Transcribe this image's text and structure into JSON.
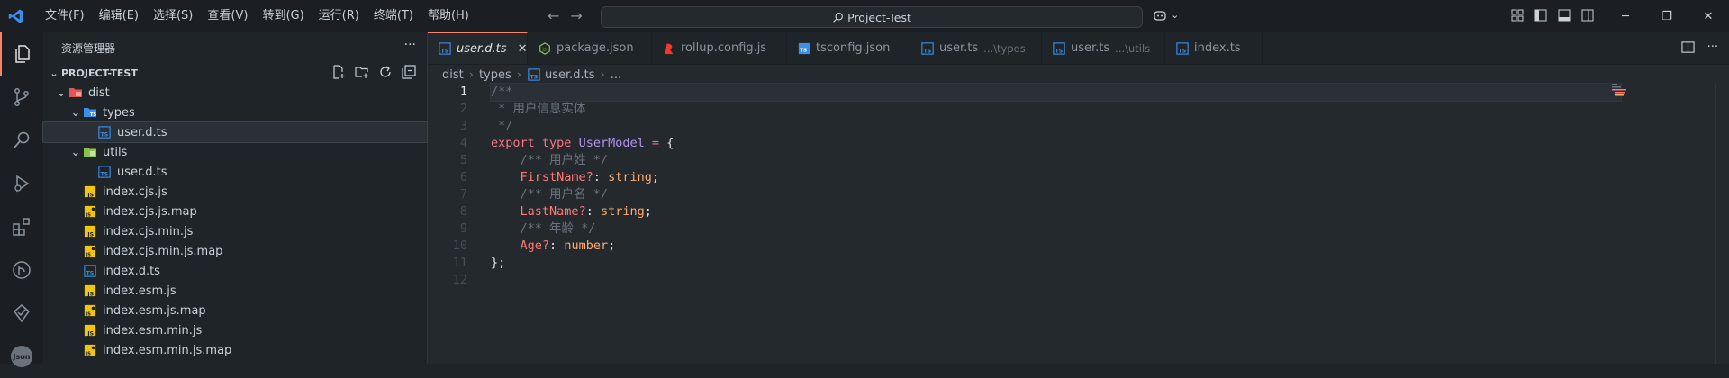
{
  "titlebar": {
    "menu": [
      "文件(F)",
      "编辑(E)",
      "选择(S)",
      "查看(V)",
      "转到(G)",
      "运行(R)",
      "终端(T)",
      "帮助(H)"
    ],
    "search_text": "Project-Test",
    "copilot_chevron": "⌄"
  },
  "colors": {
    "accent": "#f9826c",
    "ts_blue": "#3b8eea",
    "js_yellow": "#f1c40f",
    "npm_green": "#8bc34a",
    "rollup_red": "#ef3b2d"
  },
  "sidebar": {
    "title": "资源管理器",
    "more": "···",
    "project": "PROJECT-TEST",
    "tree": [
      {
        "label": "dist",
        "depth": 0,
        "kind": "folder-dist",
        "chev": "⌄"
      },
      {
        "label": "types",
        "depth": 1,
        "kind": "folder-types",
        "chev": "⌄"
      },
      {
        "label": "user.d.ts",
        "depth": 2,
        "kind": "ts",
        "selected": true
      },
      {
        "label": "utils",
        "depth": 1,
        "kind": "folder-utils",
        "chev": "⌄"
      },
      {
        "label": "user.d.ts",
        "depth": 2,
        "kind": "ts"
      },
      {
        "label": "index.cjs.js",
        "depth": 1,
        "kind": "js"
      },
      {
        "label": "index.cjs.js.map",
        "depth": 1,
        "kind": "map"
      },
      {
        "label": "index.cjs.min.js",
        "depth": 1,
        "kind": "js"
      },
      {
        "label": "index.cjs.min.js.map",
        "depth": 1,
        "kind": "map"
      },
      {
        "label": "index.d.ts",
        "depth": 1,
        "kind": "ts"
      },
      {
        "label": "index.esm.js",
        "depth": 1,
        "kind": "js"
      },
      {
        "label": "index.esm.js.map",
        "depth": 1,
        "kind": "map"
      },
      {
        "label": "index.esm.min.js",
        "depth": 1,
        "kind": "js"
      },
      {
        "label": "index.esm.min.js.map",
        "depth": 1,
        "kind": "map"
      }
    ]
  },
  "activity": {
    "bottom_badge": "Json"
  },
  "tabs": [
    {
      "label": "user.d.ts",
      "desc": "",
      "kind": "ts",
      "active": true,
      "width": 111
    },
    {
      "label": "package.json",
      "desc": "",
      "kind": "npm",
      "width": 138
    },
    {
      "label": "rollup.config.js",
      "desc": "",
      "kind": "rollup",
      "width": 150
    },
    {
      "label": "tsconfig.json",
      "desc": "",
      "kind": "tsconfig",
      "width": 137
    },
    {
      "label": "user.ts",
      "desc": "...\\types",
      "kind": "ts",
      "width": 146
    },
    {
      "label": "user.ts",
      "desc": "...\\utils",
      "kind": "ts",
      "width": 137
    },
    {
      "label": "index.ts",
      "desc": "",
      "kind": "ts",
      "width": 108
    }
  ],
  "breadcrumbs": [
    "dist",
    "types",
    "user.d.ts",
    "..."
  ],
  "code_lines": [
    {
      "n": "1",
      "current": true,
      "tokens": [
        [
          "c",
          "/**"
        ]
      ]
    },
    {
      "n": "2",
      "tokens": [
        [
          "c",
          " * 用户信息实体"
        ]
      ]
    },
    {
      "n": "3",
      "tokens": [
        [
          "c",
          " */"
        ]
      ]
    },
    {
      "n": "4",
      "tokens": [
        [
          "k",
          "export"
        ],
        [
          "p",
          " "
        ],
        [
          "k",
          "type"
        ],
        [
          "p",
          " "
        ],
        [
          "t",
          "UserModel"
        ],
        [
          "p",
          " "
        ],
        [
          "k",
          "="
        ],
        [
          "p",
          " {"
        ]
      ]
    },
    {
      "n": "5",
      "tokens": [
        [
          "p",
          "    "
        ],
        [
          "c",
          "/** 用户姓 */"
        ]
      ]
    },
    {
      "n": "6",
      "tokens": [
        [
          "p",
          "    "
        ],
        [
          "prop",
          "FirstName"
        ],
        [
          "k",
          "?"
        ],
        [
          "p",
          ": "
        ],
        [
          "ty",
          "string"
        ],
        [
          "p",
          ";"
        ]
      ]
    },
    {
      "n": "7",
      "tokens": [
        [
          "p",
          "    "
        ],
        [
          "c",
          "/** 用户名 */"
        ]
      ]
    },
    {
      "n": "8",
      "tokens": [
        [
          "p",
          "    "
        ],
        [
          "prop",
          "LastName"
        ],
        [
          "k",
          "?"
        ],
        [
          "p",
          ": "
        ],
        [
          "ty",
          "string"
        ],
        [
          "p",
          ";"
        ]
      ]
    },
    {
      "n": "9",
      "tokens": [
        [
          "p",
          "    "
        ],
        [
          "c",
          "/** 年龄 */"
        ]
      ]
    },
    {
      "n": "10",
      "tokens": [
        [
          "p",
          "    "
        ],
        [
          "prop",
          "Age"
        ],
        [
          "k",
          "?"
        ],
        [
          "p",
          ": "
        ],
        [
          "ty",
          "number"
        ],
        [
          "p",
          ";"
        ]
      ]
    },
    {
      "n": "11",
      "tokens": [
        [
          "p",
          "};"
        ]
      ]
    },
    {
      "n": "12",
      "tokens": [
        [
          "p",
          ""
        ]
      ]
    }
  ]
}
